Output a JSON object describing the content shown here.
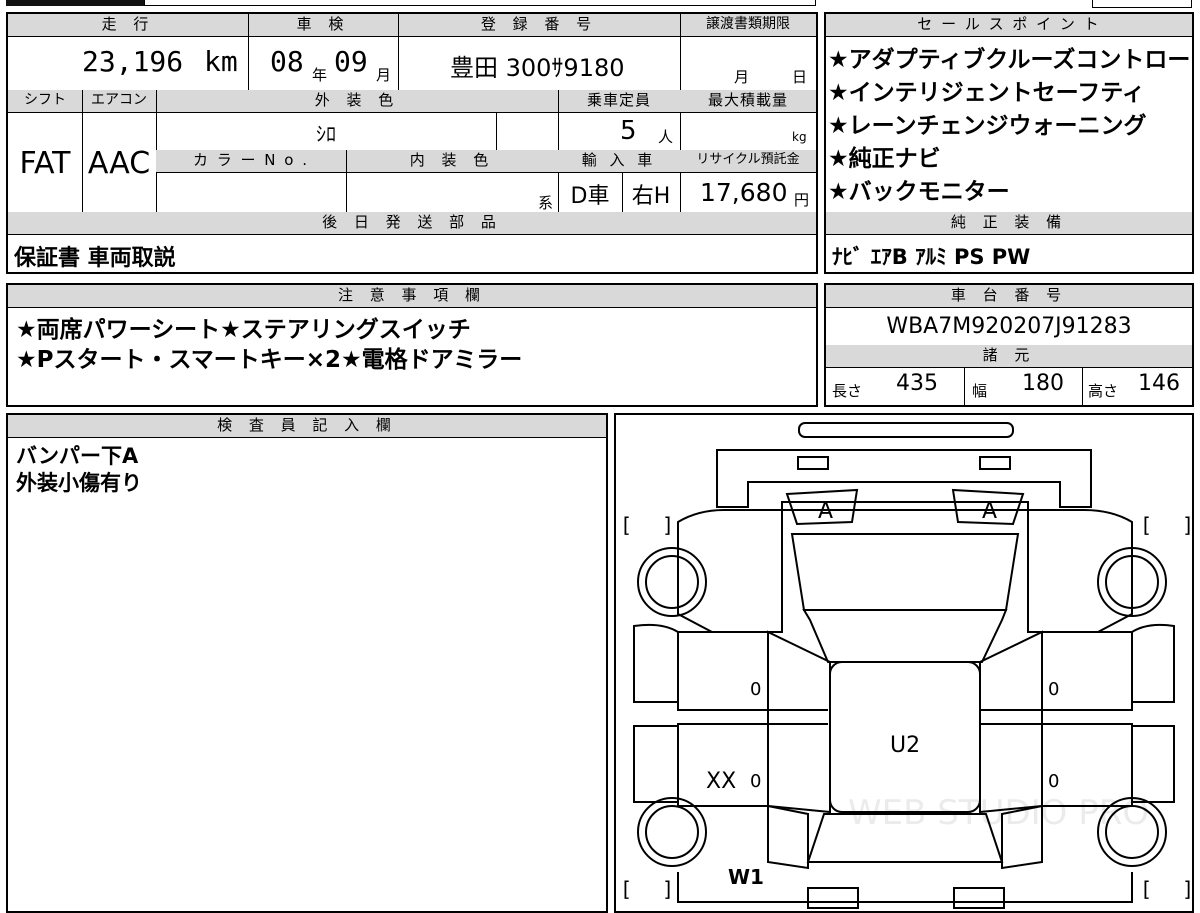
{
  "headers": {
    "mileage": "走 行",
    "inspection": "車 検",
    "registration": "登 録 番 号",
    "transfer_deadline": "譲渡書類期限",
    "sales_points": "セ ー ル ス ポ イ ン ト",
    "shift": "シフト",
    "aircon": "エアコン",
    "exterior_color": "外 装 色",
    "capacity": "乗車定員",
    "max_load": "最大積載量",
    "color_no": "カ ラ ー N o .",
    "interior_color": "内 装 色",
    "import": "輸 入 車",
    "recycle": "リサイクル預託金",
    "later_parts": "後 日 発 送 部 品",
    "genuine_equipment": "純 正 装 備",
    "notes": "注 意 事 項 欄",
    "chassis_no": "車 台 番 号",
    "specs": "諸 元",
    "inspector": "検 査 員 記 入 欄"
  },
  "values": {
    "mileage": "23,196",
    "mileage_unit": "km",
    "inspection_year": "08",
    "inspection_year_unit": "年",
    "inspection_month": "09",
    "inspection_month_unit": "月",
    "registration": "豊田 300ｻ9180",
    "transfer_month": "月",
    "transfer_day": "日",
    "shift": "FAT",
    "aircon": "AAC",
    "exterior_color": "ｼﾛ",
    "capacity": "5",
    "capacity_unit": "人",
    "max_load_unit": "kg",
    "interior_unit": "系",
    "import_type": "D車",
    "handle": "右H",
    "recycle_fee": "17,680",
    "recycle_unit": "円",
    "later_parts": "保証書 車両取説",
    "genuine_equipment": "ﾅﾋﾞ ｴｱB ｱﾙﾐ PS PW",
    "chassis_no": "WBA7M920207J91283",
    "length_label": "長さ",
    "length": "435",
    "width_label": "幅",
    "width": "180",
    "height_label": "高さ",
    "height": "146"
  },
  "sales_points": [
    "★アダプティブクルーズコントロー",
    "★インテリジェントセーフティ",
    "★レーンチェンジウォーニング",
    "★純正ナビ",
    "★バックモニター"
  ],
  "notes": [
    "★両席パワーシート★ステアリングスイッチ",
    "★Pスタート・スマートキー×2★電格ドアミラー"
  ],
  "inspector": [
    "バンパー下A",
    "外装小傷有り"
  ],
  "diagram": {
    "front_left_mark": "A",
    "front_right_mark": "A",
    "left_front_door": "0",
    "left_rear_door": "0",
    "right_front_door": "0",
    "right_rear_door": "0",
    "roof_mark": "U2",
    "left_rear_mark": "XX",
    "left_rear_bottom_mark": "W1",
    "watermark": "WEB STUDIO PRO"
  }
}
